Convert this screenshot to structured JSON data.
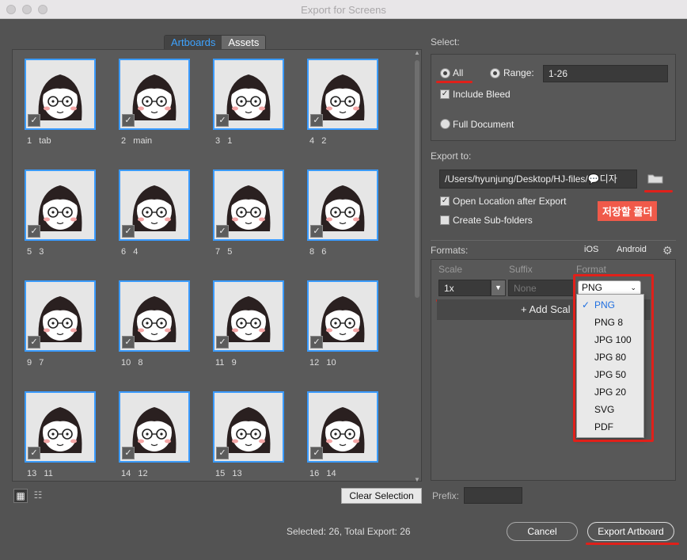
{
  "window": {
    "title": "Export for Screens"
  },
  "tabs": [
    {
      "label": "Artboards"
    },
    {
      "label": "Assets"
    }
  ],
  "artboards": [
    {
      "num": "1",
      "name": "tab"
    },
    {
      "num": "2",
      "name": "main"
    },
    {
      "num": "3",
      "name": "1"
    },
    {
      "num": "4",
      "name": "2"
    },
    {
      "num": "5",
      "name": "3"
    },
    {
      "num": "6",
      "name": "4"
    },
    {
      "num": "7",
      "name": "5"
    },
    {
      "num": "8",
      "name": "6"
    },
    {
      "num": "9",
      "name": "7"
    },
    {
      "num": "10",
      "name": "8"
    },
    {
      "num": "11",
      "name": "9"
    },
    {
      "num": "12",
      "name": "10"
    },
    {
      "num": "13",
      "name": "11"
    },
    {
      "num": "14",
      "name": "12"
    },
    {
      "num": "15",
      "name": "13"
    },
    {
      "num": "16",
      "name": "14"
    }
  ],
  "select": {
    "label": "Select:",
    "all": "All",
    "range": "Range:",
    "range_value": "1-26",
    "include_bleed": "Include Bleed",
    "full_document": "Full Document"
  },
  "export_to": {
    "label": "Export to:",
    "path": "/Users/hyunjung/Desktop/HJ-files/💬디자",
    "open_location": "Open Location after Export",
    "create_subfolders": "Create Sub-folders",
    "annotation": "저장할 폴더"
  },
  "formats": {
    "label": "Formats:",
    "ios": "iOS",
    "android": "Android",
    "col_scale": "Scale",
    "col_suffix": "Suffix",
    "col_format": "Format",
    "scale_value": "1x",
    "suffix_placeholder": "None",
    "format_value": "PNG",
    "add_scale": "+ Add Scal"
  },
  "format_menu": [
    "PNG",
    "PNG 8",
    "JPG 100",
    "JPG 80",
    "JPG 50",
    "JPG 20",
    "SVG",
    "PDF"
  ],
  "bottom": {
    "clear_selection": "Clear Selection",
    "prefix_label": "Prefix:",
    "status": "Selected: 26, Total Export: 26",
    "cancel": "Cancel",
    "export": "Export Artboard"
  },
  "colors": {
    "accent": "#3a9bff",
    "annotation_red": "#e0201a"
  }
}
